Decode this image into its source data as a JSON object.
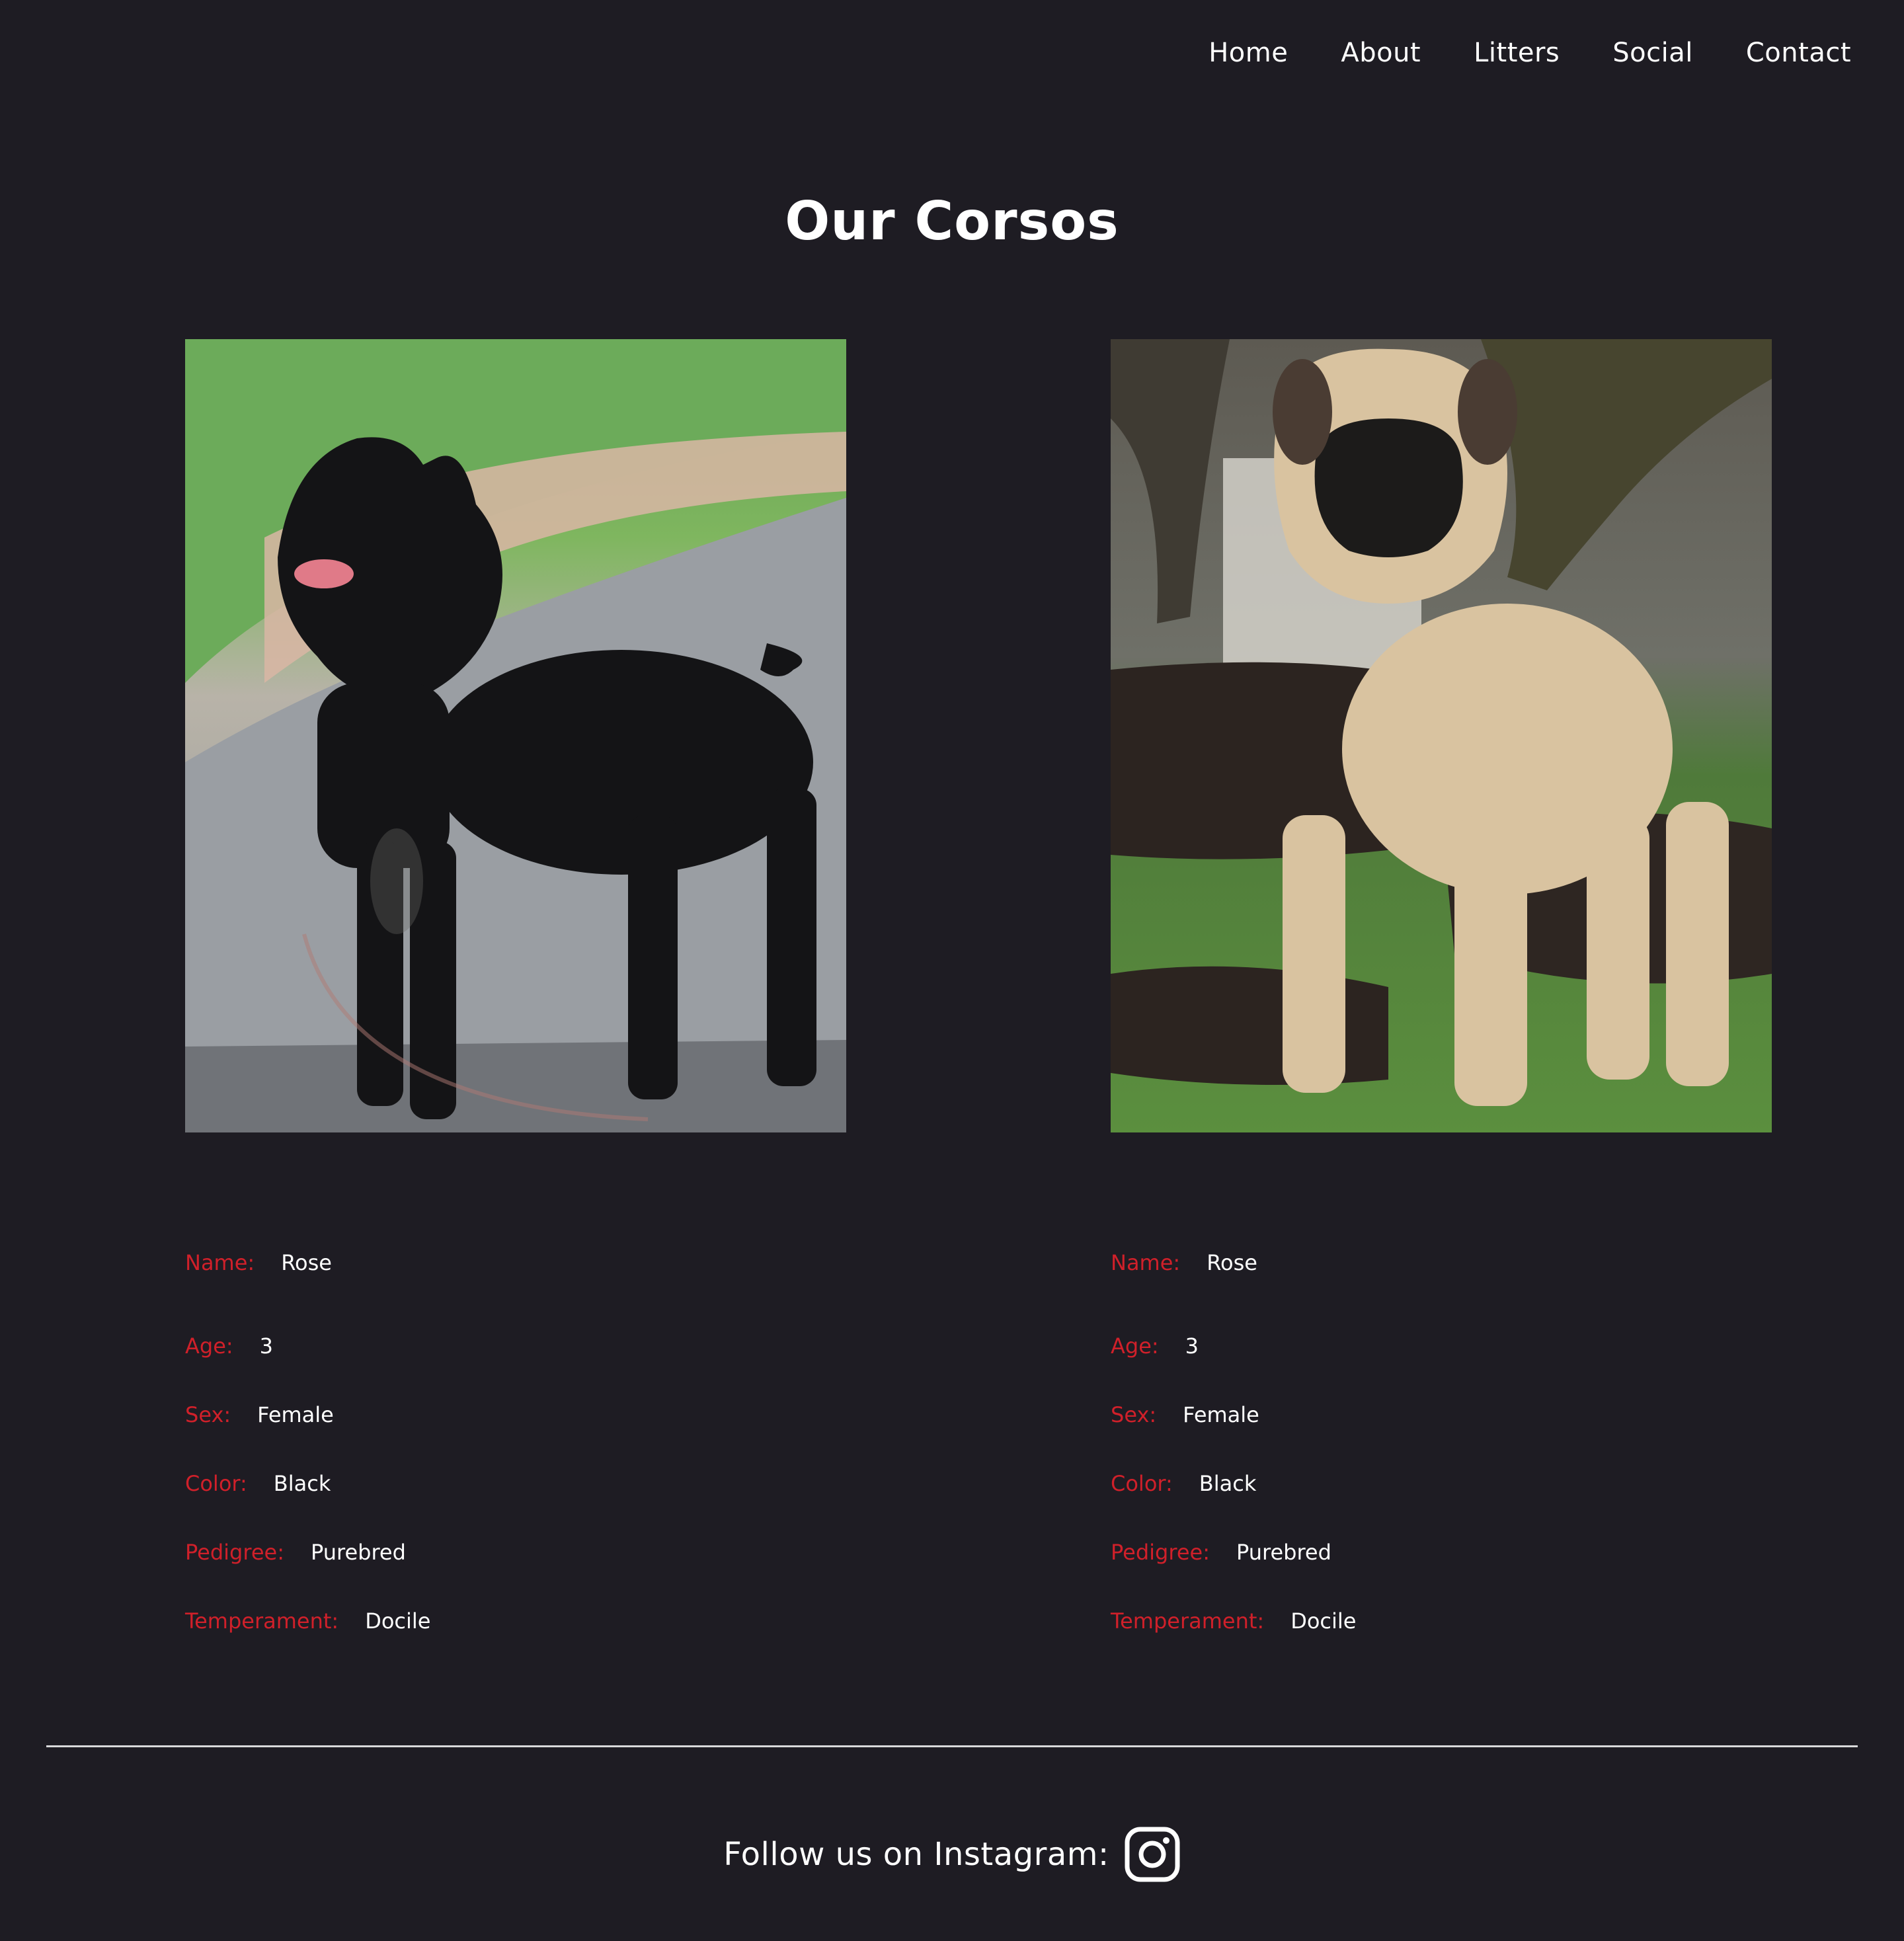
{
  "nav": {
    "items": [
      {
        "label": "Home"
      },
      {
        "label": "About"
      },
      {
        "label": "Litters"
      },
      {
        "label": "Social"
      },
      {
        "label": "Contact"
      }
    ]
  },
  "page": {
    "title": "Our Corsos"
  },
  "dogs": [
    {
      "photo_icon": "black-cane-corso-photo",
      "fields": [
        {
          "label": "Name:",
          "value": "Rose"
        },
        {
          "label": "Age:",
          "value": "3"
        },
        {
          "label": "Sex:",
          "value": "Female"
        },
        {
          "label": "Color:",
          "value": "Black"
        },
        {
          "label": "Pedigree:",
          "value": "Purebred"
        },
        {
          "label": "Temperament:",
          "value": "Docile"
        }
      ]
    },
    {
      "photo_icon": "fawn-mastiff-photo",
      "fields": [
        {
          "label": "Name:",
          "value": "Rose"
        },
        {
          "label": "Age:",
          "value": "3"
        },
        {
          "label": "Sex:",
          "value": "Female"
        },
        {
          "label": "Color:",
          "value": "Black"
        },
        {
          "label": "Pedigree:",
          "value": "Purebred"
        },
        {
          "label": "Temperament:",
          "value": "Docile"
        }
      ]
    }
  ],
  "footer": {
    "text": "Follow us on Instagram:",
    "icon": "instagram-icon"
  },
  "colors": {
    "background": "#1e1c23",
    "label_accent": "#d0202a",
    "text": "#ffffff",
    "divider": "#d8d8da"
  }
}
